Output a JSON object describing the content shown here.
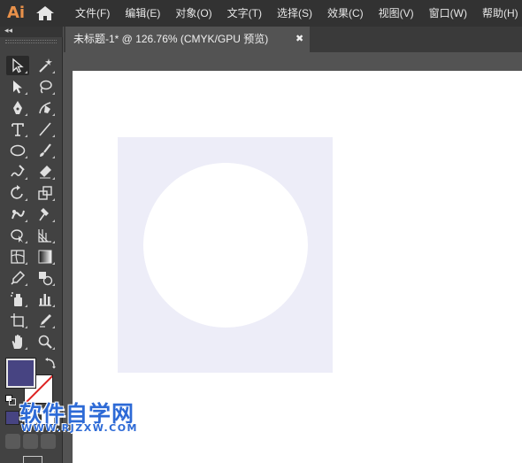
{
  "app": {
    "logo_text": "Ai",
    "accent": "#e8914a"
  },
  "menu": {
    "items": [
      "文件(F)",
      "编辑(E)",
      "对象(O)",
      "文字(T)",
      "选择(S)",
      "效果(C)",
      "视图(V)",
      "窗口(W)",
      "帮助(H)"
    ]
  },
  "toolpanel": {
    "collapse_glyph": "◂◂",
    "fill_color": "#474482",
    "stroke_color": "none"
  },
  "document_tab": {
    "title": "未标题-1* @ 126.76% (CMYK/GPU 预览)",
    "close_glyph": "✖"
  },
  "canvas": {
    "rect_fill": "#ededf8",
    "circle_fill": "#ffffff"
  },
  "watermark": {
    "title": "软件自学网",
    "url": "WWW.RJZXW.COM"
  }
}
